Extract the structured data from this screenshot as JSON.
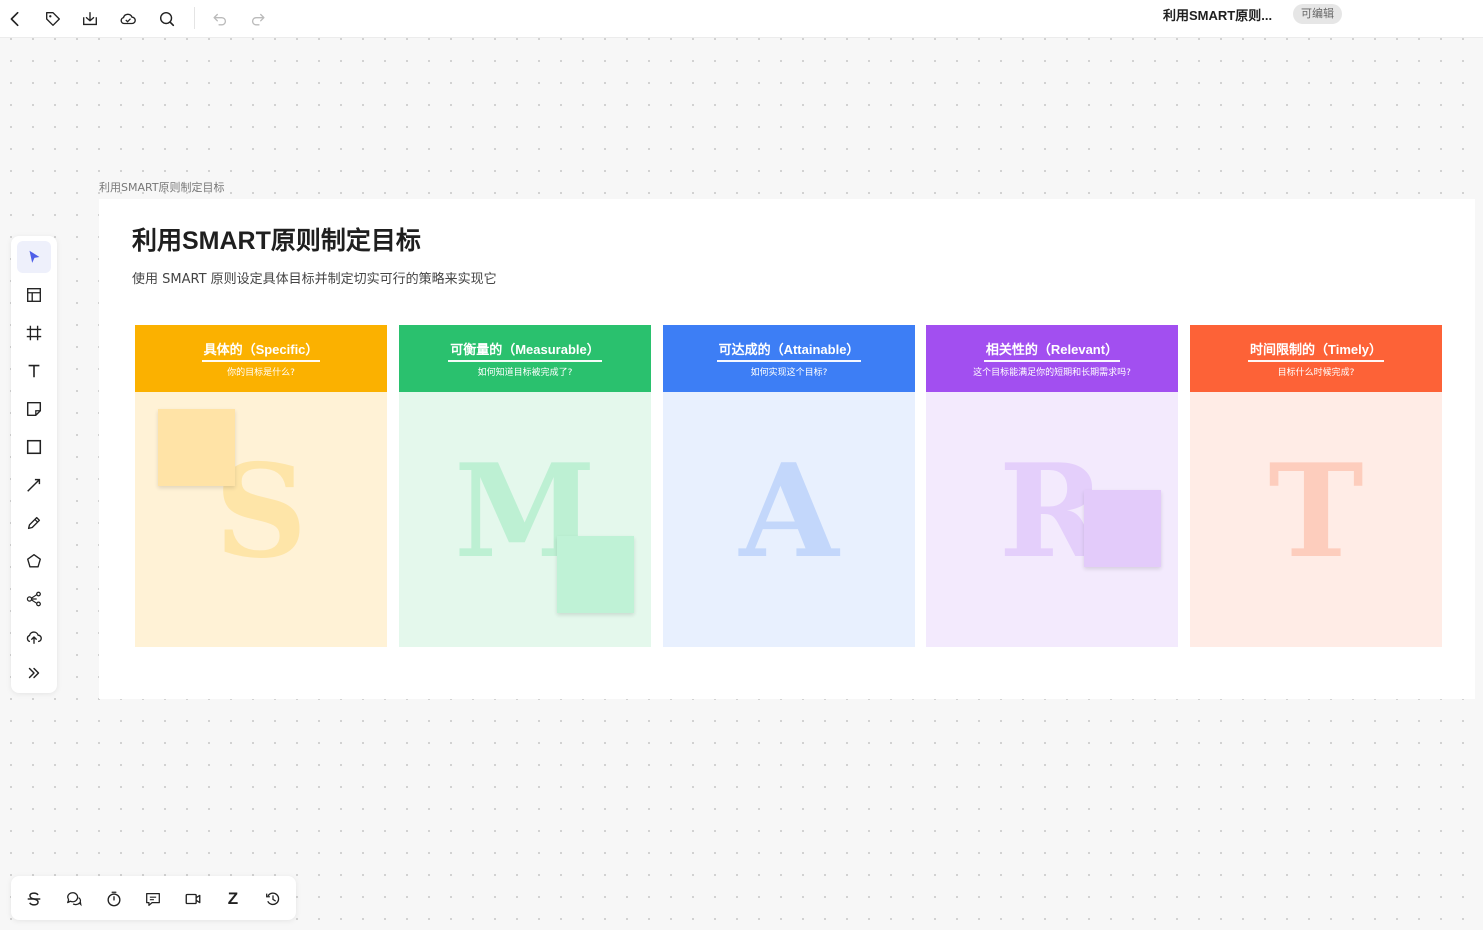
{
  "topbar": {
    "doc_title": "利用SMART原则...",
    "edit_badge": "可编辑",
    "icons": [
      "back-icon",
      "tag-icon",
      "download-icon",
      "cloud-icon",
      "search-icon",
      "undo-icon",
      "redo-icon"
    ]
  },
  "board": {
    "frame_label": "利用SMART原则制定目标",
    "title": "利用SMART原则制定目标",
    "subtitle": "使用 SMART 原则设定具体目标并制定切实可行的策略来实现它",
    "cards": [
      {
        "title": "具体的（Specific）",
        "question": "你的目标是什么?",
        "letter": "S",
        "head_color": "#fbb100",
        "body_color": "#fff2d6",
        "letter_color": "#fee5a8",
        "sticky_color": "#ffe3a6"
      },
      {
        "title": "可衡量的（Measurable）",
        "question": "如何知道目标被完成了?",
        "letter": "M",
        "head_color": "#2ac16e",
        "body_color": "#e4f8ec",
        "letter_color": "#bdf0d3",
        "sticky_color": "#bff2d6"
      },
      {
        "title": "可达成的（Attainable）",
        "question": "如何实现这个目标?",
        "letter": "A",
        "head_color": "#3d7ef5",
        "body_color": "#e8f0fe",
        "letter_color": "#c3d7fb",
        "sticky_color": "#c3d7fb"
      },
      {
        "title": "相关性的（Relevant）",
        "question": "这个目标能满足你的短期和长期需求吗?",
        "letter": "R",
        "head_color": "#a24ff0",
        "body_color": "#f3eafd",
        "letter_color": "#e4cffb",
        "sticky_color": "#e3cbfa"
      },
      {
        "title": "时间限制的（Timely）",
        "question": "目标什么时候完成?",
        "letter": "T",
        "head_color": "#fd6237",
        "body_color": "#ffece6",
        "letter_color": "#fdcdbd",
        "sticky_color": "#fdcdbd"
      }
    ]
  },
  "left_toolbar": {
    "tools": [
      "select-tool-icon",
      "template-icon",
      "frame-icon",
      "text-icon",
      "sticky-note-icon",
      "rectangle-icon",
      "line-icon",
      "pen-icon",
      "shape-icon",
      "mindmap-icon",
      "upload-icon",
      "more-icon"
    ]
  },
  "bottom_toolbar": {
    "tools": [
      "strikethrough-icon",
      "comment-icon",
      "timer-icon",
      "chat-icon",
      "video-icon",
      "sleep-icon",
      "history-icon"
    ],
    "z_glyph": "Z"
  }
}
